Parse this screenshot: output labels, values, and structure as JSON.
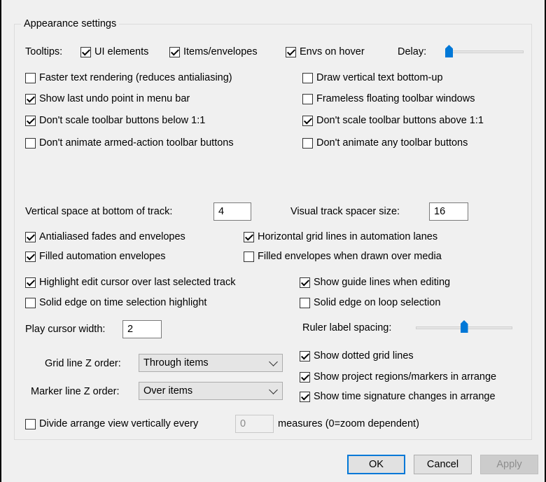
{
  "group": {
    "title": "Appearance settings"
  },
  "tooltips": {
    "label": "Tooltips:",
    "ui_elements": {
      "label": "UI elements",
      "checked": true
    },
    "items_envelopes": {
      "label": "Items/envelopes",
      "checked": true
    },
    "envs_on_hover": {
      "label": "Envs on hover",
      "checked": true
    },
    "delay_label": "Delay:",
    "delay_value": 0.0
  },
  "options": {
    "faster_text": {
      "label": "Faster text rendering (reduces antialiasing)",
      "checked": false
    },
    "vertical_text": {
      "label": "Draw vertical text bottom-up",
      "checked": false
    },
    "undo_point": {
      "label": "Show last undo point in menu bar",
      "checked": true
    },
    "frameless": {
      "label": "Frameless floating toolbar windows",
      "checked": false
    },
    "scale_below": {
      "label": "Don't scale toolbar buttons below 1:1",
      "checked": true
    },
    "scale_above": {
      "label": "Don't scale toolbar buttons above 1:1",
      "checked": true
    },
    "animate_armed": {
      "label": "Don't animate armed-action toolbar buttons",
      "checked": false
    },
    "animate_any": {
      "label": "Don't animate any toolbar buttons",
      "checked": false
    }
  },
  "track": {
    "vspace_label": "Vertical space at bottom of track:",
    "vspace_value": "4",
    "spacer_label": "Visual track spacer size:",
    "spacer_value": "16"
  },
  "envelopes": {
    "antialiased": {
      "label": "Antialiased fades and envelopes",
      "checked": true
    },
    "hgrid": {
      "label": "Horizontal grid lines in automation lanes",
      "checked": true
    },
    "filled_auto": {
      "label": "Filled automation envelopes",
      "checked": true
    },
    "filled_media": {
      "label": "Filled envelopes when drawn over media",
      "checked": false
    }
  },
  "editing": {
    "highlight_cursor": {
      "label": "Highlight edit cursor over last selected track",
      "checked": true
    },
    "guide_lines": {
      "label": "Show guide lines when editing",
      "checked": true
    },
    "solid_time_sel": {
      "label": "Solid edge on time selection highlight",
      "checked": false
    },
    "solid_loop_sel": {
      "label": "Solid edge on loop selection",
      "checked": false
    }
  },
  "cursor": {
    "width_label": "Play cursor width:",
    "width_value": "2",
    "ruler_label": "Ruler label spacing:",
    "ruler_value": 0.5
  },
  "zorder": {
    "grid_label": "Grid line Z order:",
    "grid_value": "Through items",
    "marker_label": "Marker line Z order:",
    "marker_value": "Over items"
  },
  "arrange": {
    "dotted_grid": {
      "label": "Show dotted grid lines",
      "checked": true
    },
    "regions_markers": {
      "label": "Show project regions/markers in arrange",
      "checked": true
    },
    "time_sig": {
      "label": "Show time signature changes in arrange",
      "checked": true
    }
  },
  "divide": {
    "label": "Divide arrange view vertically every",
    "checked": false,
    "value": "0",
    "suffix": "measures (0=zoom dependent)"
  },
  "buttons": {
    "ok": "OK",
    "cancel": "Cancel",
    "apply": "Apply"
  }
}
